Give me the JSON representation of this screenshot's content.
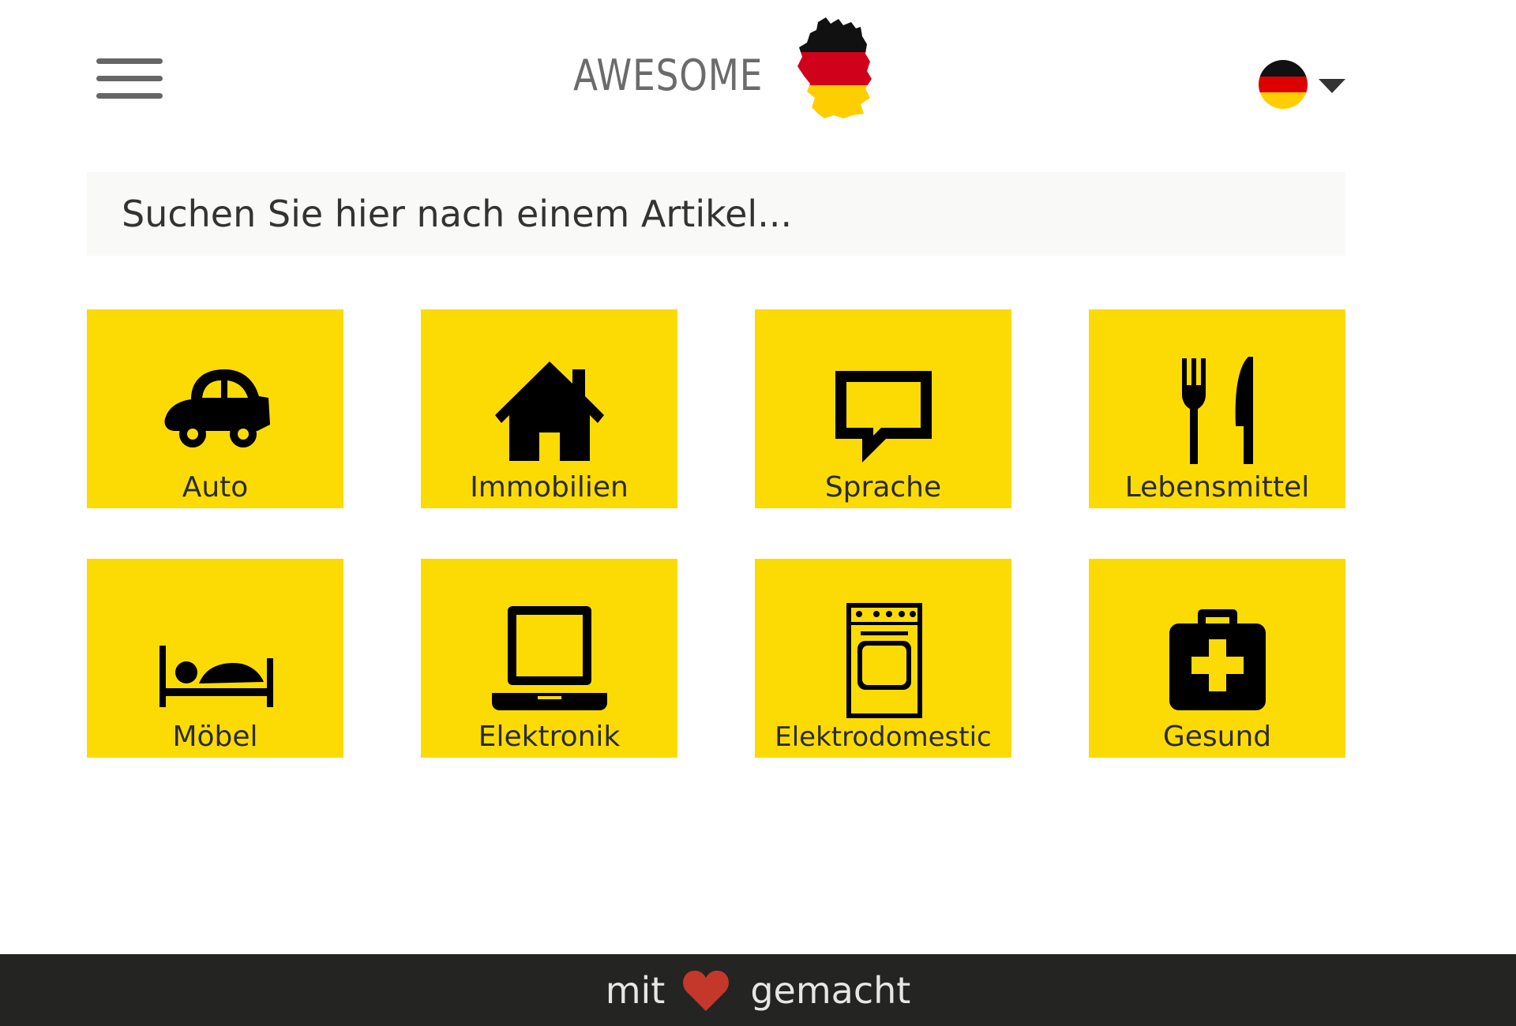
{
  "header": {
    "menu_icon": "hamburger-menu-icon",
    "logo": {
      "text": "AWESOME",
      "map_icon": "germany-map-flag-icon"
    },
    "language": {
      "flag_icon": "germany-flag-icon",
      "flag_colors": [
        "#000000",
        "#dd0000",
        "#ffce00"
      ],
      "caret_icon": "caret-down-icon"
    }
  },
  "search": {
    "placeholder": "Suchen Sie hier nach einem Artikel...",
    "value": ""
  },
  "categories": [
    {
      "label": "Auto",
      "icon": "car-icon"
    },
    {
      "label": "Immobilien",
      "icon": "house-icon"
    },
    {
      "label": "Sprache",
      "icon": "speech-bubble-icon"
    },
    {
      "label": "Lebensmittel",
      "icon": "fork-knife-icon"
    },
    {
      "label": "Möbel",
      "icon": "bed-icon"
    },
    {
      "label": "Elektronik",
      "icon": "laptop-icon"
    },
    {
      "label": "Elektrodomestic",
      "icon": "stove-icon"
    },
    {
      "label": "Gesund",
      "icon": "first-aid-kit-icon"
    }
  ],
  "footer": {
    "prefix": "mit",
    "heart_icon": "heart-icon",
    "suffix": "gemacht"
  },
  "colors": {
    "tile_background": "#fcdb05",
    "footer_background": "#242422",
    "heart": "#c4382b",
    "logo_text": "#6b6b6b"
  }
}
